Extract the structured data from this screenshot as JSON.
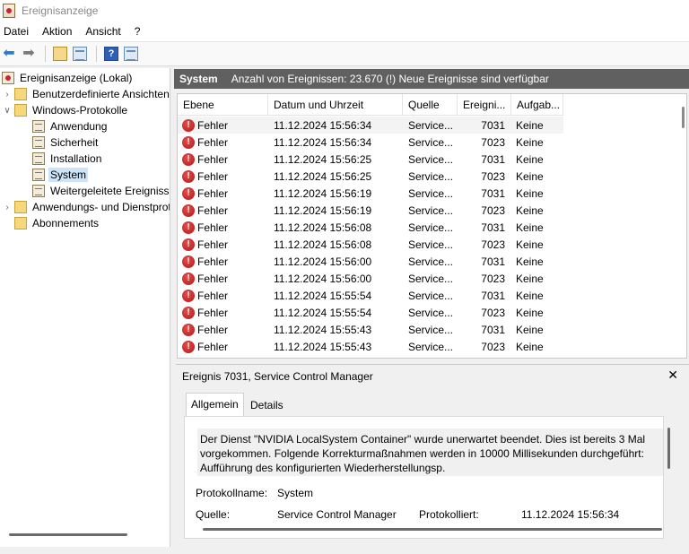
{
  "window": {
    "title": "Ereignisanzeige"
  },
  "menu": [
    "Datei",
    "Aktion",
    "Ansicht",
    "?"
  ],
  "tree": {
    "root": "Ereignisanzeige (Lokal)",
    "custom_views": "Benutzerdefinierte Ansichten",
    "windows_logs": "Windows-Protokolle",
    "logs": [
      "Anwendung",
      "Sicherheit",
      "Installation",
      "System",
      "Weitergeleitete Ereignisse"
    ],
    "app_services": "Anwendungs- und Dienstprotokolle",
    "subscriptions": "Abonnements"
  },
  "header": {
    "log_name": "System",
    "summary": "Anzahl von Ereignissen: 23.670 (!) Neue Ereignisse sind verfügbar"
  },
  "grid": {
    "columns": [
      "Ebene",
      "Datum und Uhrzeit",
      "Quelle",
      "Ereigni...",
      "Aufgab..."
    ],
    "rows": [
      {
        "level": "Fehler",
        "date": "11.12.2024 15:56:34",
        "source": "Service...",
        "id": "7031",
        "task": "Keine"
      },
      {
        "level": "Fehler",
        "date": "11.12.2024 15:56:34",
        "source": "Service...",
        "id": "7023",
        "task": "Keine"
      },
      {
        "level": "Fehler",
        "date": "11.12.2024 15:56:25",
        "source": "Service...",
        "id": "7031",
        "task": "Keine"
      },
      {
        "level": "Fehler",
        "date": "11.12.2024 15:56:25",
        "source": "Service...",
        "id": "7023",
        "task": "Keine"
      },
      {
        "level": "Fehler",
        "date": "11.12.2024 15:56:19",
        "source": "Service...",
        "id": "7031",
        "task": "Keine"
      },
      {
        "level": "Fehler",
        "date": "11.12.2024 15:56:19",
        "source": "Service...",
        "id": "7023",
        "task": "Keine"
      },
      {
        "level": "Fehler",
        "date": "11.12.2024 15:56:08",
        "source": "Service...",
        "id": "7031",
        "task": "Keine"
      },
      {
        "level": "Fehler",
        "date": "11.12.2024 15:56:08",
        "source": "Service...",
        "id": "7023",
        "task": "Keine"
      },
      {
        "level": "Fehler",
        "date": "11.12.2024 15:56:00",
        "source": "Service...",
        "id": "7031",
        "task": "Keine"
      },
      {
        "level": "Fehler",
        "date": "11.12.2024 15:56:00",
        "source": "Service...",
        "id": "7023",
        "task": "Keine"
      },
      {
        "level": "Fehler",
        "date": "11.12.2024 15:55:54",
        "source": "Service...",
        "id": "7031",
        "task": "Keine"
      },
      {
        "level": "Fehler",
        "date": "11.12.2024 15:55:54",
        "source": "Service...",
        "id": "7023",
        "task": "Keine"
      },
      {
        "level": "Fehler",
        "date": "11.12.2024 15:55:43",
        "source": "Service...",
        "id": "7031",
        "task": "Keine"
      },
      {
        "level": "Fehler",
        "date": "11.12.2024 15:55:43",
        "source": "Service...",
        "id": "7023",
        "task": "Keine"
      }
    ]
  },
  "detail": {
    "title": "Ereignis 7031, Service Control Manager",
    "tabs": [
      "Allgemein",
      "Details"
    ],
    "description": "Der Dienst \"NVIDIA LocalSystem Container\" wurde unerwartet beendet. Dies ist bereits 3 Mal vorgekommen. Folgende Korrekturmaßnahmen werden in 10000 Millisekunden durchgeführt: Aufführung des konfigurierten Wiederherstellungsp.",
    "log_label": "Protokollname:",
    "log_value": "System",
    "source_label": "Quelle:",
    "source_value": "Service Control Manager",
    "logged_label": "Protokolliert:",
    "logged_value": "11.12.2024 15:56:34"
  }
}
